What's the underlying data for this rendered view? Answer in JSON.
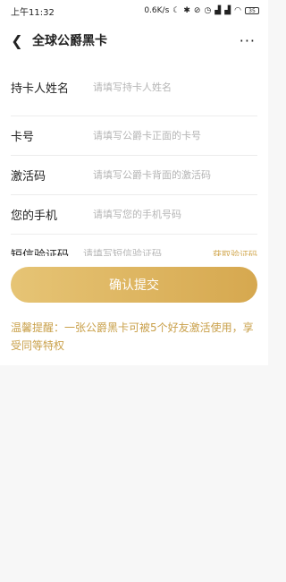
{
  "status_bar": {
    "time": "上午11:32",
    "network_speed": "0.6K/s",
    "battery_level": "35"
  },
  "nav": {
    "title": "全球公爵黑卡",
    "more": "···"
  },
  "form": {
    "rows": [
      {
        "label": "持卡人姓名",
        "placeholder": "请填写持卡人姓名"
      },
      {
        "label": "卡号",
        "placeholder": "请填写公爵卡正面的卡号"
      },
      {
        "label": "激活码",
        "placeholder": "请填写公爵卡背面的激活码"
      },
      {
        "label": "您的手机",
        "placeholder": "请填写您的手机号码"
      },
      {
        "label": "短信验证码",
        "placeholder": "请填写短信验证码",
        "action": "获取验证码"
      }
    ]
  },
  "submit_label": "确认提交",
  "tip": "温馨提醒：一张公爵黑卡可被5个好友激活使用，享受同等特权",
  "colors": {
    "accent": "#d6a84f",
    "tip_text": "#c9a04a"
  }
}
